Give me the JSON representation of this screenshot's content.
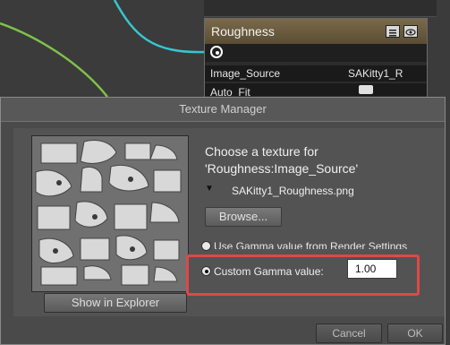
{
  "node": {
    "title": "Roughness",
    "property_name": "Image_Source",
    "property_value": "SAKitty1_R",
    "auto_fit_label": "Auto_Fit",
    "icons": [
      "menu-icon",
      "eye-icon"
    ]
  },
  "dialog": {
    "title": "Texture Manager",
    "prompt_line1": "Choose a texture for",
    "prompt_line2": "'Roughness:Image_Source'",
    "selected_texture": "SAKitty1_Roughness.png",
    "browse_label": "Browse...",
    "gamma_render_label": "Use Gamma value from Render Settings",
    "custom_gamma_label": "Custom Gamma value:",
    "custom_gamma_value": "1.00",
    "show_in_explorer_label": "Show in Explorer",
    "cancel_label": "Cancel",
    "ok_label": "OK",
    "highlight_color": "#e04848"
  },
  "colors": {
    "canvas_bg": "#3a3a3a",
    "node_header": "#6b5b3f",
    "wire_cyan": "#35c7cf",
    "wire_green": "#7fc24a",
    "dialog_bg": "#4a4a4a"
  }
}
